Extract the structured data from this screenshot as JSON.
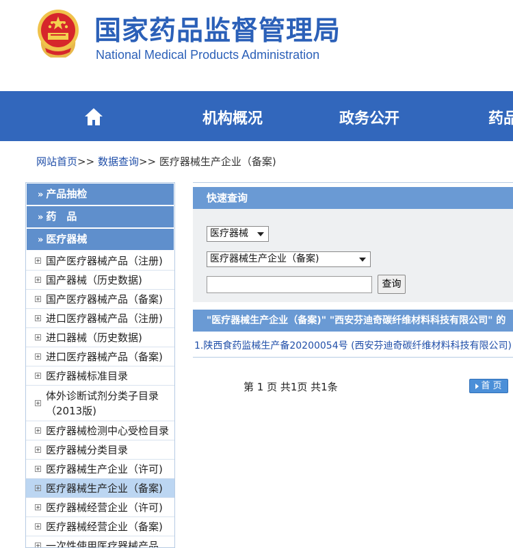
{
  "header": {
    "title_cn": "国家药品监督管理局",
    "title_en": "National Medical Products Administration",
    "emblem_icon": "national-emblem-icon"
  },
  "nav": {
    "home_icon": "home-icon",
    "items": [
      "机构概况",
      "政务公开",
      "药品"
    ]
  },
  "breadcrumb": {
    "items": [
      "网站首页",
      "数据查询",
      "医疗器械生产企业（备案)"
    ],
    "separator": ">>"
  },
  "sidebar": {
    "sections": [
      "产品抽检",
      "药　品",
      "医疗器械"
    ],
    "items": [
      "国产医疗器械产品（注册)",
      "国产器械（历史数据)",
      "国产医疗器械产品（备案)",
      "进口医疗器械产品（注册)",
      "进口器械（历史数据)",
      "进口医疗器械产品（备案)",
      "医疗器械标准目录",
      "体外诊断试剂分类子目录（2013版)",
      "医疗器械检测中心受检目录",
      "医疗器械分类目录",
      "医疗器械生产企业（许可)",
      "医疗器械生产企业（备案)",
      "医疗器械经营企业（许可)",
      "医疗器械经营企业（备案)",
      "一次性使用医疗器械产品"
    ],
    "active_index": 11
  },
  "main": {
    "quick_search_title": "快速查询",
    "category_select": "医疗器械",
    "subcategory_select": "医疗器械生产企业（备案)",
    "search_input_value": "",
    "search_button": "查询",
    "result_header": "\"医疗器械生产企业（备案)\" \"西安芬迪奇碳纤维材料科技有限公司\" 的",
    "result_items": [
      "1.陕西食药监械生产备20200054号 (西安芬迪奇碳纤维材料科技有限公司)"
    ],
    "pager_text": "第 1 页 共1页 共1条",
    "first_page_button": "首 页"
  },
  "colors": {
    "brand_blue": "#3267bc",
    "title_blue": "#2b60b8",
    "panel_blue": "#6a9ad4",
    "sidebar_head": "#5f8fcc",
    "active_item": "#bcd6f2"
  }
}
